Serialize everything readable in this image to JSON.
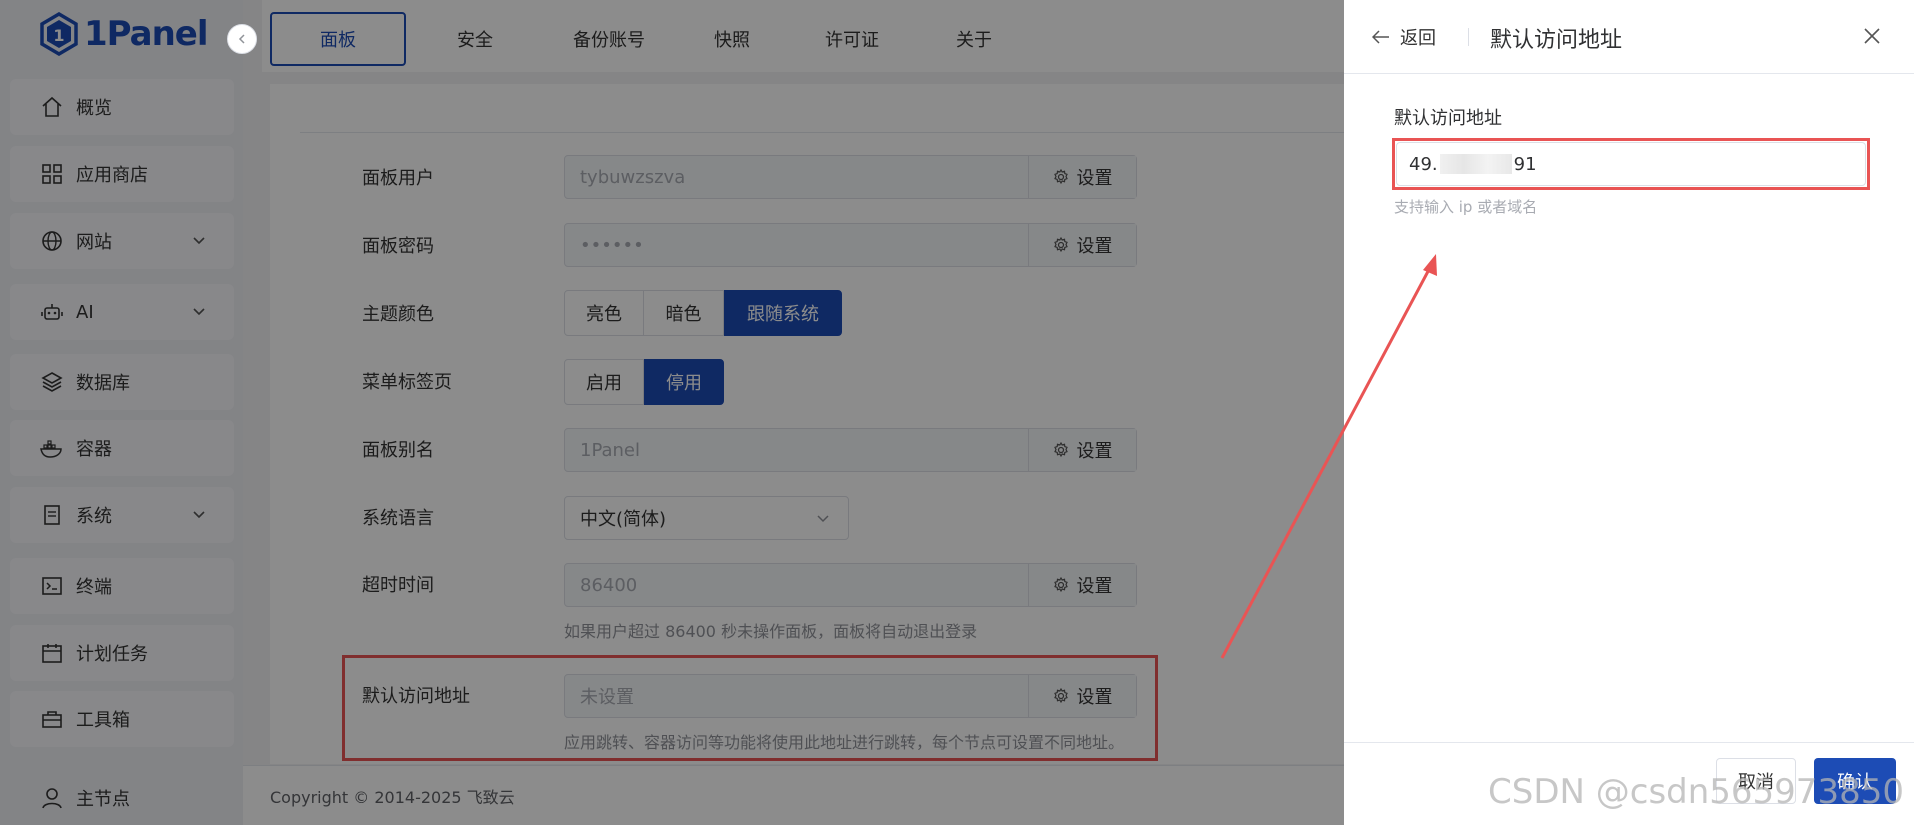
{
  "app": {
    "logo_text": "1Panel"
  },
  "sidebar": {
    "items": [
      {
        "label": "概览",
        "icon": "home-icon"
      },
      {
        "label": "应用商店",
        "icon": "grid-icon"
      },
      {
        "label": "网站",
        "icon": "globe-icon",
        "has_children": true
      },
      {
        "label": "AI",
        "icon": "robot-icon",
        "has_children": true
      },
      {
        "label": "数据库",
        "icon": "layers-icon"
      },
      {
        "label": "容器",
        "icon": "docker-icon"
      },
      {
        "label": "系统",
        "icon": "document-icon",
        "has_children": true
      },
      {
        "label": "终端",
        "icon": "terminal-icon"
      },
      {
        "label": "计划任务",
        "icon": "calendar-icon"
      },
      {
        "label": "工具箱",
        "icon": "toolbox-icon"
      }
    ],
    "bottom_node": {
      "label": "主节点",
      "icon": "user-icon"
    }
  },
  "tabs": [
    {
      "label": "面板",
      "active": true
    },
    {
      "label": "安全"
    },
    {
      "label": "备份账号"
    },
    {
      "label": "快照"
    },
    {
      "label": "许可证"
    },
    {
      "label": "关于"
    }
  ],
  "settings": {
    "panel_user": {
      "label": "面板用户",
      "value": "tybuwzszva",
      "button": "设置"
    },
    "panel_password": {
      "label": "面板密码",
      "value": "••••••",
      "button": "设置"
    },
    "theme": {
      "label": "主题颜色",
      "options": [
        "亮色",
        "暗色",
        "跟随系统"
      ],
      "selected": "跟随系统"
    },
    "menu_tabs": {
      "label": "菜单标签页",
      "options": [
        "启用",
        "停用"
      ],
      "selected": "停用"
    },
    "panel_alias": {
      "label": "面板别名",
      "value": "1Panel",
      "button": "设置"
    },
    "language": {
      "label": "系统语言",
      "value": "中文(简体)"
    },
    "timeout": {
      "label": "超时时间",
      "value": "86400",
      "button": "设置",
      "hint": "如果用户超过 86400 秒未操作面板，面板将自动退出登录"
    },
    "default_address": {
      "label": "默认访问地址",
      "placeholder": "未设置",
      "button": "设置",
      "hint": "应用跳转、容器访问等功能将使用此地址进行跳转，每个节点可设置不同地址。"
    }
  },
  "footer": {
    "copyright": "Copyright © 2014-2025 飞致云"
  },
  "drawer": {
    "back_label": "返回",
    "title": "默认访问地址",
    "field_label": "默认访问地址",
    "field_value_prefix": "49.",
    "field_value_suffix": "91",
    "field_hint": "支持输入 ip 或者域名",
    "cancel_label": "取消",
    "confirm_label": "确认"
  },
  "watermark": "CSDN @csdn565973850",
  "colors": {
    "primary": "#1d4cb5",
    "highlight": "#e95454"
  }
}
